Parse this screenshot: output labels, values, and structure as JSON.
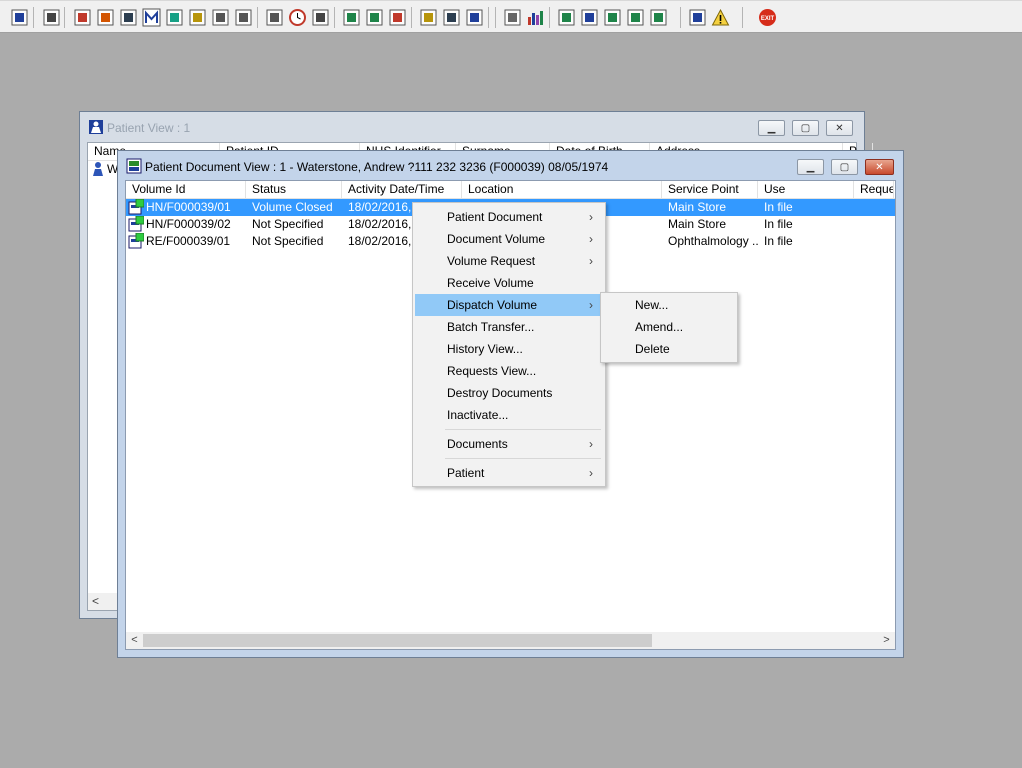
{
  "toolbar": {
    "icons": [
      "user-icon",
      "printer-icon",
      "book-icon",
      "folder-icon",
      "register-icon",
      "m-icon",
      "person-icon",
      "edit-icon",
      "tools-icon",
      "tools2-icon",
      "search-icon",
      "clock-icon",
      "monitor-icon",
      "document-icon",
      "document2-icon",
      "globe-icon",
      "notes-icon",
      "printer2-icon",
      "person2-icon",
      "page-icon",
      "chart-icon",
      "globe2-icon",
      "transfer-icon",
      "transfer2-icon",
      "transfer3-icon",
      "transfer4-icon",
      "swap-icon",
      "warning-icon",
      "exit-icon"
    ],
    "exit_label": "EXIT"
  },
  "patient_view": {
    "title": "Patient View : 1",
    "columns": [
      "Name",
      "Patient ID",
      "NHS Identifier",
      "Surname",
      "Date of Birth",
      "Address",
      "P"
    ],
    "row_text": "W"
  },
  "document_view": {
    "title": "Patient Document View : 1 - Waterstone, Andrew ?111 232 3236 (F000039) 08/05/1974",
    "columns": [
      "Volume Id",
      "Status",
      "Activity Date/Time",
      "Location",
      "Service Point",
      "Use",
      "Reque"
    ],
    "rows": [
      {
        "volume_id": "HN/F000039/01",
        "status": "Volume Closed",
        "activity": "18/02/2016,",
        "location": "",
        "service_point": "Main Store",
        "use": "In file",
        "selected": true
      },
      {
        "volume_id": "HN/F000039/02",
        "status": "Not Specified",
        "activity": "18/02/2016,",
        "location": "",
        "service_point": "Main Store",
        "use": "In file",
        "selected": false
      },
      {
        "volume_id": "RE/F000039/01",
        "status": "Not Specified",
        "activity": "18/02/2016,",
        "location": "",
        "service_point": "Ophthalmology ...",
        "use": "In file",
        "selected": false
      }
    ]
  },
  "context_menu": {
    "items": [
      {
        "label": "Patient Document",
        "submenu": true
      },
      {
        "label": "Document Volume",
        "submenu": true
      },
      {
        "label": "Volume Request",
        "submenu": true
      },
      {
        "label": "Receive Volume",
        "submenu": false
      },
      {
        "label": "Dispatch Volume",
        "submenu": true,
        "highlighted": true
      },
      {
        "label": "Batch Transfer...",
        "submenu": false
      },
      {
        "label": "History View...",
        "submenu": false
      },
      {
        "label": "Requests View...",
        "submenu": false
      },
      {
        "label": "Destroy Documents",
        "submenu": false
      },
      {
        "label": "Inactivate...",
        "submenu": false
      },
      {
        "label": "Documents",
        "submenu": true
      },
      {
        "label": "Patient",
        "submenu": true
      }
    ],
    "submenu_arrow": "›"
  },
  "dispatch_submenu": {
    "items": [
      "New...",
      "Amend...",
      "Delete"
    ]
  },
  "colors": {
    "desktop": "#ababab",
    "selection": "#3399ff",
    "menu_highlight": "#91c9f7"
  }
}
